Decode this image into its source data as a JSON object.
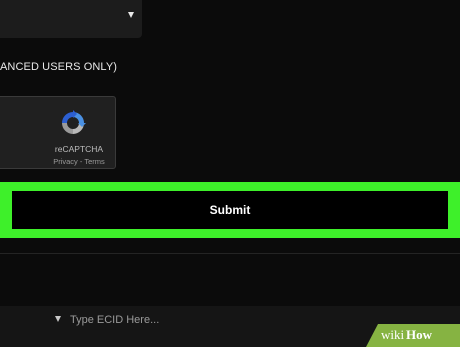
{
  "select": {
    "icon": "chevron-down-icon"
  },
  "advanced_label": "ANCED USERS ONLY)",
  "captcha": {
    "name": "reCAPTCHA",
    "links": "Privacy - Terms",
    "icon": "recaptcha-logo-icon"
  },
  "submit": {
    "label": "Submit",
    "highlight_color": "#3ef02a"
  },
  "ecid": {
    "placeholder": "Type ECID Here...",
    "icon": "chevron-down-icon"
  },
  "watermark": {
    "wiki": "wiki",
    "how": "How",
    "color": "#86b342"
  }
}
